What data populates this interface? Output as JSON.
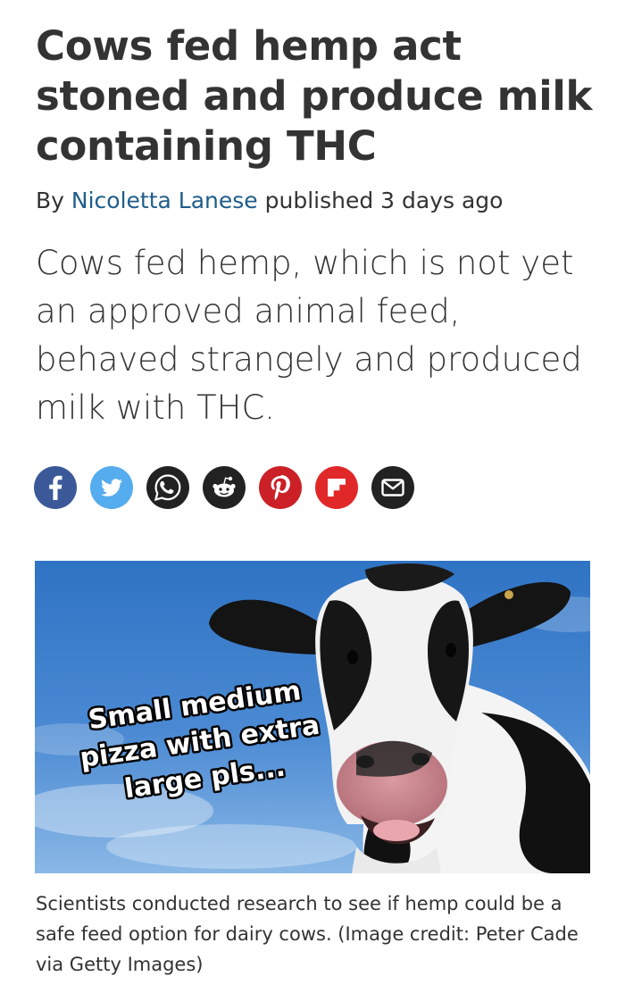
{
  "article": {
    "title": "Cows fed hemp act stoned and produce milk containing THC",
    "byline": {
      "prefix": "By",
      "author": "Nicoletta Lanese",
      "published": "published 3 days ago"
    },
    "strapline": "Cows fed hemp, which is not yet an approved animal feed, behaved strangely and produced milk with THC.",
    "share_buttons": [
      {
        "name": "facebook",
        "icon": "facebook-icon",
        "color": "#3b5998"
      },
      {
        "name": "twitter",
        "icon": "twitter-icon",
        "color": "#55acee"
      },
      {
        "name": "whatsapp",
        "icon": "whatsapp-icon",
        "color": "#222222"
      },
      {
        "name": "reddit",
        "icon": "reddit-icon",
        "color": "#222222"
      },
      {
        "name": "pinterest",
        "icon": "pinterest-icon",
        "color": "#cb2027"
      },
      {
        "name": "flipboard",
        "icon": "flipboard-icon",
        "color": "#e12828"
      },
      {
        "name": "email",
        "icon": "email-icon",
        "color": "#222222"
      }
    ],
    "image": {
      "meme_text": [
        "Small medium",
        "pizza with extra",
        "large pls..."
      ]
    },
    "caption": "Scientists conducted research to see if hemp could be a safe feed option for dairy cows. (Image credit: Peter Cade via Getty Images)"
  }
}
